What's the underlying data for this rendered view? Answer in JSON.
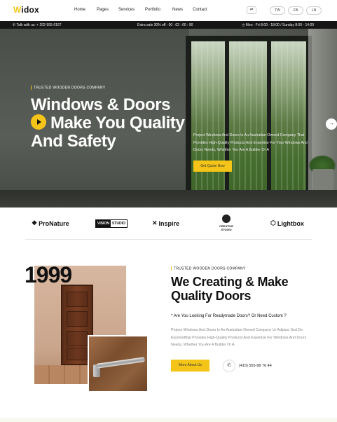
{
  "header": {
    "logo": "Widox",
    "nav": [
      "Home",
      "Pages",
      "Services",
      "Portfolio",
      "News",
      "Contact"
    ],
    "cart_icon": "cart-icon",
    "social": [
      "TW",
      "FB",
      "LN"
    ]
  },
  "topbar": {
    "phone": "Talk with us: + 202-555-0167",
    "promo": "Extra sale 30% off : 00 : 02 : 00 : 90",
    "hours": "Mon - Fri 8:00 - 18:00 / Sunday 8:00 - 14:00"
  },
  "hero": {
    "tag": "TRUSTED WOODEN DOORS COMPANY",
    "title_line1": "Windows & Doors",
    "title_line2": "Make You Quality",
    "title_line3": "And Safety",
    "description": "Project Windows And Doors Is An Australian-Owned Company That Provides High-Quality Products And Expertise For Your Windows And Doors Needs, Whether You Are A Builder Or A",
    "cta": "Get Quote Now",
    "next_arrow": "→"
  },
  "brands": {
    "items": [
      "ProNature",
      "Inspire",
      "Lightbox"
    ],
    "vision_left": "VISION",
    "vision_right": "STUDIO",
    "creative": "CREATIVE STUDIO"
  },
  "about": {
    "year": "1999",
    "tag": "TRUSTED WOODEN DOORS COMPANY",
    "title": "We Creating & Make Quality Doors",
    "question": "* Are You Looking For Readymade Doors? Or Need Custom ?",
    "text": "Project Windows And Doors Is An Australian-Owned Company Ur Adipisci Sed Do Eiusmodthat Provides High-Quality Products And Expertise For Windows And Doors Needs, Whether You Are A Builder Or A",
    "button": "More About Us",
    "phone": "(415) 555-98 76 44"
  },
  "colors": {
    "accent": "#f4c518",
    "dark": "#161616"
  }
}
